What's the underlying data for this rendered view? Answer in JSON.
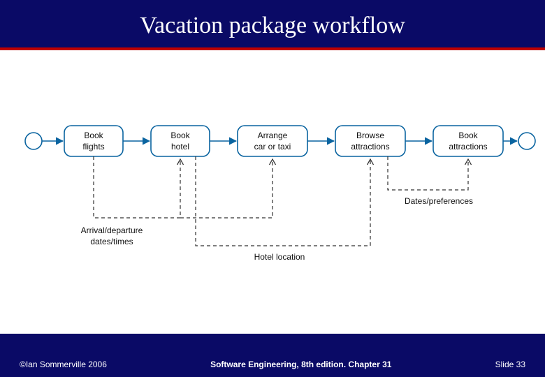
{
  "slide": {
    "title": "Vacation package workflow",
    "footer": {
      "copyright": "©Ian Sommerville 2006",
      "center": "Software Engineering, 8th edition. Chapter 31",
      "slide_label": "Slide",
      "slide_number": "33"
    }
  },
  "chart_data": {
    "type": "workflow",
    "start_node": true,
    "end_node": true,
    "activities": [
      {
        "id": "book_flights",
        "label_line1": "Book",
        "label_line2": "flights"
      },
      {
        "id": "book_hotel",
        "label_line1": "Book",
        "label_line2": "hotel"
      },
      {
        "id": "arrange_car",
        "label_line1": "Arrange",
        "label_line2": "car or taxi"
      },
      {
        "id": "browse_attractions",
        "label_line1": "Browse",
        "label_line2": "attractions"
      },
      {
        "id": "book_attractions",
        "label_line1": "Book",
        "label_line2": "attractions"
      }
    ],
    "annotations": [
      {
        "id": "arrival_departure",
        "text_line1": "Arrival/departure",
        "text_line2": "dates/times",
        "from": "book_flights",
        "to": [
          "book_hotel",
          "arrange_car"
        ]
      },
      {
        "id": "hotel_location",
        "text_line1": "Hotel location",
        "from": "book_hotel",
        "to": [
          "browse_attractions"
        ]
      },
      {
        "id": "dates_preferences",
        "text_line1": "Dates/preferences",
        "from": "browse_attractions",
        "to": [
          "book_attractions"
        ]
      }
    ]
  }
}
